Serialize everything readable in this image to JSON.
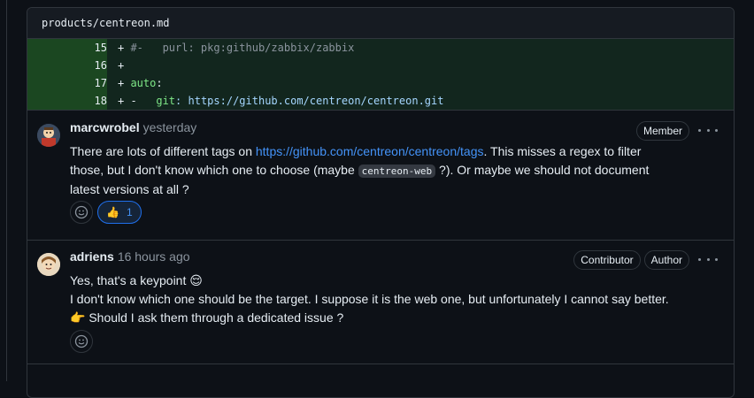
{
  "file": {
    "path": "products/centreon.md"
  },
  "diff": {
    "lines": [
      {
        "num": "15",
        "sign": "+",
        "parts": [
          {
            "t": "#-   purl: pkg:github/zabbix/zabbix",
            "c": "tok-c"
          }
        ]
      },
      {
        "num": "16",
        "sign": "+",
        "parts": []
      },
      {
        "num": "17",
        "sign": "+",
        "parts": [
          {
            "t": "auto",
            "c": "tok-k"
          },
          {
            "t": ":",
            "c": ""
          }
        ]
      },
      {
        "num": "18",
        "sign": "+",
        "parts": [
          {
            "t": "-   ",
            "c": ""
          },
          {
            "t": "git",
            "c": "tok-k"
          },
          {
            "t": ": https://github.com/centreon/centreon.git",
            "c": "tok-s"
          }
        ]
      }
    ]
  },
  "comments": [
    {
      "author": "marcwrobel",
      "time": "yesterday",
      "badges": [
        "Member"
      ],
      "text_1": "There are lots of different tags on ",
      "link": "https://github.com/centreon/centreon/tags",
      "text_2": ". This misses a regex to filter",
      "text_3": "those, but I don't know which one to choose (maybe ",
      "code": "centreon-web",
      "text_4": " ?). Or maybe we should not document",
      "text_5": "latest versions at all ?",
      "reaction_emoji": "👍",
      "reaction_count": "1"
    },
    {
      "author": "adriens",
      "time": "16 hours ago",
      "badges": [
        "Contributor",
        "Author"
      ],
      "line_1": "Yes, that's a keypoint 😌",
      "line_2": "I don't know which one should be the target. I suppose it is the web one, but unfortunately I cannot say better.",
      "line_3": "👉 Should I ask them through a dedicated issue ?"
    }
  ],
  "colors": {
    "accent": "#4493f8",
    "diff_bg": "#12261e",
    "diff_num_bg": "#1b4721"
  },
  "icons": [
    "smiley-icon",
    "kebab-icon",
    "thumbs-up-icon"
  ]
}
